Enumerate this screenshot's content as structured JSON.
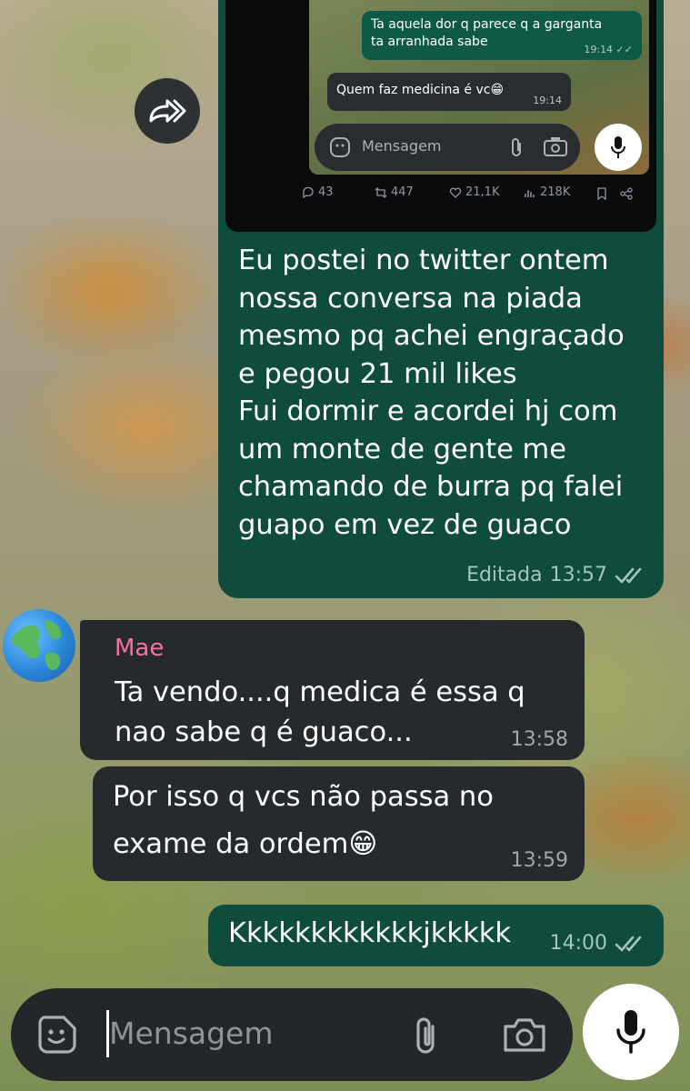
{
  "shared_screenshot": {
    "outgoing_message": "Ta aquela dor q parece q a garganta\nta arranhada sabe",
    "outgoing_time": "19:14",
    "incoming_message": "Quem faz medicina é vc😁",
    "incoming_time": "19:14",
    "input_placeholder": "Mensagem",
    "stats": {
      "replies": "43",
      "retweets": "447",
      "likes": "21,1K",
      "views": "218K"
    }
  },
  "messages": [
    {
      "direction": "outgoing",
      "text": "Eu postei no twitter ontem\nnossa conversa na piada\nmesmo pq achei engraçado\ne pegou 21 mil likes\nFui dormir e acordei hj com\num monte de gente me\nchamando de burra pq falei\nguapo em vez de guaco",
      "edited_label": "Editada",
      "time": "13:57"
    },
    {
      "direction": "incoming",
      "sender": "Mae",
      "text": "Ta vendo....q medica é essa q\nnao sabe q é guaco...",
      "time": "13:58"
    },
    {
      "direction": "incoming",
      "text": "Por isso q vcs não passa no\nexame da ordem😁",
      "time": "13:59"
    },
    {
      "direction": "outgoing",
      "text": "Kkkkkkkkkkkkjkkkkk",
      "time": "14:00"
    }
  ],
  "composer": {
    "placeholder": "Mensagem"
  },
  "colors": {
    "outgoing_bubble": "#0f4c3e",
    "incoming_bubble": "#262a2d",
    "sender_name": "#f472a4"
  },
  "icons": {
    "forward": "forward-icon",
    "sticker": "sticker-icon",
    "attach": "paperclip-icon",
    "camera": "camera-icon",
    "mic": "microphone-icon",
    "read_receipt": "double-check-icon"
  }
}
